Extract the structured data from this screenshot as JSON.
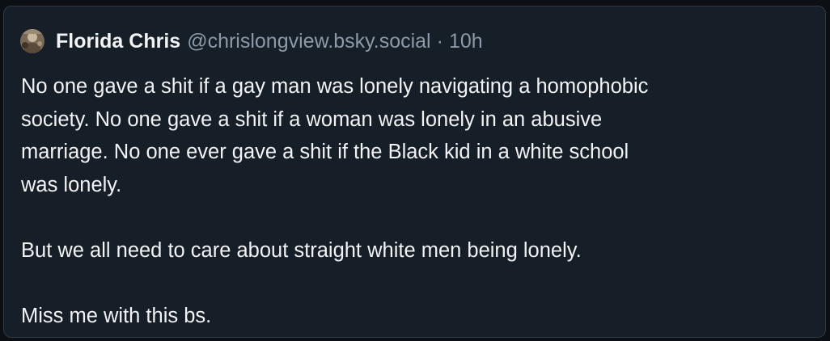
{
  "post": {
    "author": {
      "display_name": "Florida Chris",
      "handle": "@chrislongview.bsky.social",
      "avatar_icon": "profile-photo"
    },
    "separator": "·",
    "timestamp": "10h",
    "paragraphs": [
      "No one gave a shit if a gay man was lonely navigating a homophobic\nsociety. No one gave a shit if a woman was lonely in an abusive\nmarriage. No one ever gave a shit if the Black kid in a white school\nwas lonely.",
      "But we all need to care about straight white men being lonely.",
      "Miss me with this bs."
    ]
  },
  "colors": {
    "page_background": "#0c0f14",
    "card_background": "#161e27",
    "card_border": "#2e3a46",
    "primary_text": "#f1f3f5",
    "secondary_text": "#8c9aa8"
  }
}
